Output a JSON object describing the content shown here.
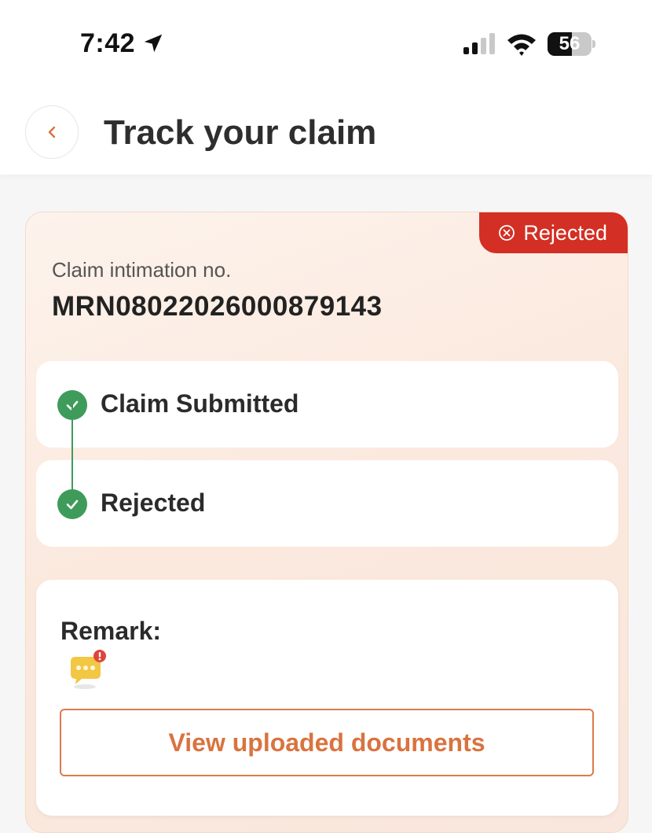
{
  "status_bar": {
    "time": "7:42",
    "battery_level": "56",
    "battery_fraction": 0.56
  },
  "header": {
    "title": "Track your claim",
    "back_icon": "chevron-left-icon"
  },
  "claim": {
    "status_badge": "Rejected",
    "status_color": "#d32f24",
    "intimation_label": "Claim intimation no.",
    "intimation_number": "MRN08022026000879143"
  },
  "timeline": {
    "steps": [
      {
        "label": "Claim Submitted",
        "done": true
      },
      {
        "label": "Rejected",
        "done": true
      }
    ],
    "done_color": "#3f9b5a"
  },
  "remark": {
    "title": "Remark:",
    "icon": "chat-alert-icon",
    "button_label": "View uploaded documents",
    "accent_color": "#d9733f"
  }
}
